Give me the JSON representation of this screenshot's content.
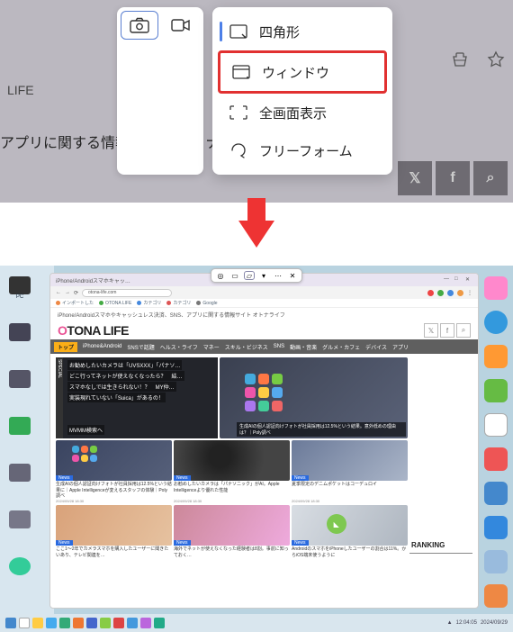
{
  "toolbar": {
    "mode_camera": "camera",
    "mode_video": "video"
  },
  "dropdown": {
    "items": [
      {
        "icon": "rectangle-icon",
        "label": "四角形"
      },
      {
        "icon": "window-icon",
        "label": "ウィンドウ"
      },
      {
        "icon": "fullscreen-icon",
        "label": "全画面表示"
      },
      {
        "icon": "freeform-icon",
        "label": "フリーフォーム"
      }
    ]
  },
  "browser_ext_icon": "ext",
  "bg": {
    "life": "LIFE",
    "tagline": "アプリに関する情報サイト オトナラ"
  },
  "social": {
    "x": "𝕏",
    "fb": "f",
    "search": "⌕"
  },
  "result": {
    "window_tab": "iPhone/Androidスマホキャッ…",
    "url": "otona-life.com",
    "crumb": "iPhone/Androidスマホやキャッシュレス決済、SNS、アプリに関する情報サイト オトナライフ",
    "logo": {
      "o": "O",
      "rest": "TONA LIFE"
    },
    "nav": [
      "トップ",
      "iPhone&Android",
      "SNSで話題",
      "ヘルス・ライフ",
      "マネー",
      "スキル・ビジネス",
      "SNS",
      "動画・音楽",
      "グルメ・カフェ",
      "デバイス",
      "アプリ"
    ],
    "hero_lines": [
      "お勧めしたいカメラは「UVSXXX」「パナソ…",
      "どこ行ってネットが使えなくなったら？　結…",
      "スマホなしでは生きられない！？　MY仲…",
      "実装現れていない「Suica」があるの！",
      "MVMM検索へ"
    ],
    "hero_right_tag": "生成AIの個人認証向けフォトが社員採用は12.5%という結果。意外低めの理由は？｜Poly調べ",
    "cards": [
      {
        "badge": "News",
        "text": "生成AIの個人認証向けフォトが社員採用は12.5%という結果に｜Apple Intelligenceが変えるスタッフの体験｜Poly調べ",
        "date": "2024/09/28 18:30"
      },
      {
        "badge": "News",
        "text": "お勧めしたいカメラは「パナソニック」がAI。Apple Intelligenceより優れた性能",
        "date": "2024/09/28 18:30"
      },
      {
        "badge": "News",
        "text": "夏季限定のデニムポケットはコーデュロイ",
        "date": "2024/09/28 18:30"
      }
    ],
    "cards2": [
      {
        "badge": "News",
        "text": "ここ1～2年でカメラスマホを購入したユーザーに聞きたいあり、テレビ関連を…"
      },
      {
        "badge": "News",
        "text": "海外でネットが使えなくなった経験者は8割。事前に知っておく…"
      },
      {
        "badge": "News",
        "text": "AndroidのスマホをiPhoneしたユーザーの割合は11%。からiOS端末使うように"
      }
    ],
    "ranking": "RANKING",
    "time": "12:04:05",
    "date": "2024/09/29"
  }
}
